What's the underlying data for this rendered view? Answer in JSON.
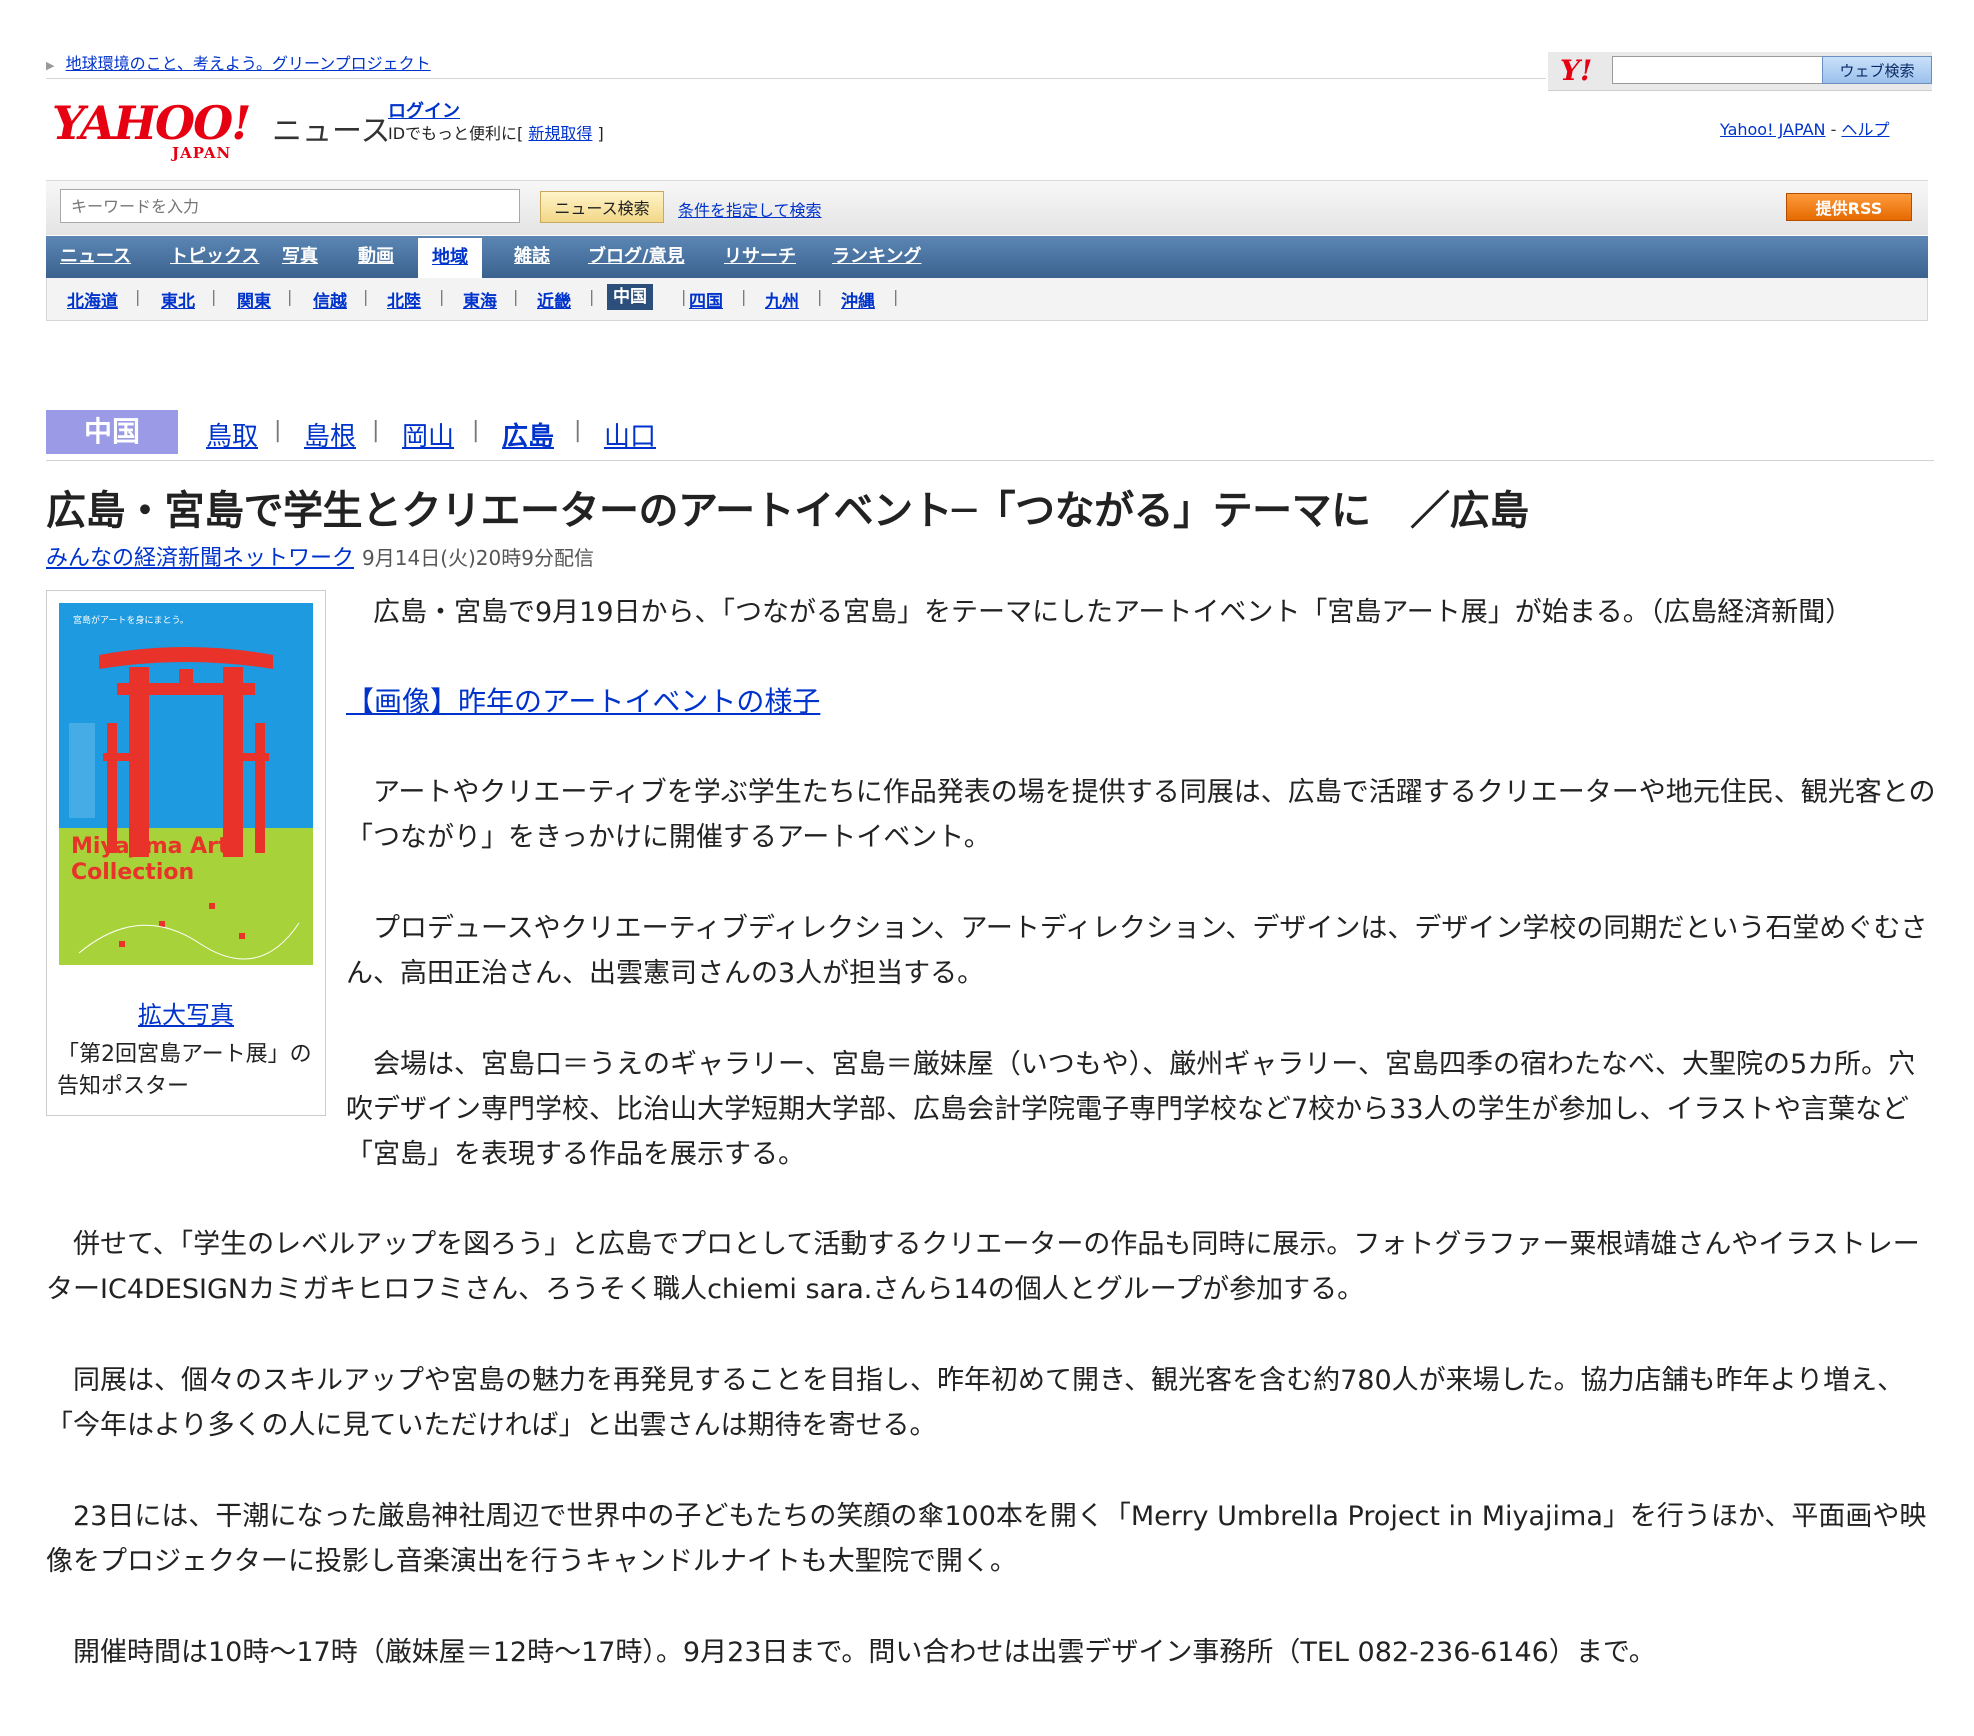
{
  "header": {
    "green_link": "地球環境のこと、考えよう。グリーンプロジェクト",
    "yahoo_small_logo": "Y!",
    "web_search_button": "ウェブ検索",
    "logo_text": "YAHOO!",
    "logo_sub": "JAPAN",
    "news_label": "ニュース",
    "login_link": "ログイン",
    "login_desc_prefix": "IDでもっと便利に[",
    "signup_link": "新規取得",
    "login_desc_suffix": "]",
    "yahoo_japan_link": "Yahoo! JAPAN",
    "dash": "-",
    "help_link": "ヘルプ"
  },
  "search": {
    "keyword_placeholder": "キーワードを入力",
    "news_search_button": "ニュース検索",
    "condition_link": "条件を指定して検索",
    "rss_button": "提供RSS"
  },
  "main_nav": [
    {
      "label": "ニュース"
    },
    {
      "label": "トピックス"
    },
    {
      "label": "写真"
    },
    {
      "label": "動画"
    },
    {
      "label": "地域"
    },
    {
      "label": "雑誌"
    },
    {
      "label": "ブログ/意見"
    },
    {
      "label": "リサーチ"
    },
    {
      "label": "ランキング"
    }
  ],
  "sub_nav": [
    {
      "label": "北海道"
    },
    {
      "label": "東北"
    },
    {
      "label": "関東"
    },
    {
      "label": "信越"
    },
    {
      "label": "北陸"
    },
    {
      "label": "東海"
    },
    {
      "label": "近畿"
    },
    {
      "label": "中国"
    },
    {
      "label": "四国"
    },
    {
      "label": "九州"
    },
    {
      "label": "沖縄"
    }
  ],
  "sub_nav_separator": "|",
  "prefectures": {
    "region": "中国",
    "items": [
      {
        "label": "鳥取"
      },
      {
        "label": "島根"
      },
      {
        "label": "岡山"
      },
      {
        "label": "広島"
      },
      {
        "label": "山口"
      }
    ]
  },
  "article": {
    "headline": "広島・宮島で学生とクリエーターのアートイベント─「つながる」テーマに　／広島",
    "source_link": "みんなの経済新聞ネットワーク",
    "date": "9月14日(火)20時9分配信",
    "poster_top_text": "宮島がアートを身にまとう。",
    "poster_title_1": "Miyajima Art",
    "poster_title_2": "Collection",
    "enlarge_link": "拡大写真",
    "caption": "「第2回宮島アート展」の告知ポスター",
    "lead": "　広島・宮島で9月19日から、「つながる宮島」をテーマにしたアートイベント「宮島アート展」が始まる。（広島経済新聞）",
    "image_link": "【画像】昨年のアートイベントの様子",
    "paragraphs": [
      "　アートやクリエーティブを学ぶ学生たちに作品発表の場を提供する同展は、広島で活躍するクリエーターや地元住民、観光客との「つながり」をきっかけに開催するアートイベント。",
      "　プロデュースやクリエーティブディレクション、アートディレクション、デザインは、デザイン学校の同期だという石堂めぐむさん、高田正治さん、出雲憲司さんの3人が担当する。",
      "　会場は、宮島口＝うえのギャラリー、宮島＝厳妹屋（いつもや）、厳州ギャラリー、宮島四季の宿わたなべ、大聖院の5カ所。穴吹デザイン専門学校、比治山大学短期大学部、広島会計学院電子専門学校など7校から33人の学生が参加し、イラストや言葉など「宮島」を表現する作品を展示する。",
      "　併せて、「学生のレベルアップを図ろう」と広島でプロとして活動するクリエーターの作品も同時に展示。フォトグラファー粟根靖雄さんやイラストレーターIC4DESIGNカミガキヒロフミさん、ろうそく職人chiemi sara.さんら14の個人とグループが参加する。",
      "　同展は、個々のスキルアップや宮島の魅力を再発見することを目指し、昨年初めて開き、観光客を含む約780人が来場した。協力店舗も昨年より増え、「今年はより多くの人に見ていただければ」と出雲さんは期待を寄せる。",
      "　23日には、干潮になった厳島神社周辺で世界中の子どもたちの笑顔の傘100本を開く「Merry Umbrella Project in Miyajima」を行うほか、平面画や映像をプロジェクターに投影し音楽演出を行うキャンドルナイトも大聖院で開く。",
      "　開催時間は10時～17時（厳妹屋＝12時～17時）。9月23日まで。問い合わせは出雲デザイン事務所（TEL 082-236-6146）まで。"
    ]
  },
  "colors": {
    "yahoo_red": "#e60012",
    "nav_blue": "#3b628f",
    "link_blue": "#0033cc",
    "region_purple": "#9a9ae6",
    "rss_orange": "#f07d12",
    "poster_blue": "#1e9ae0",
    "poster_green": "#a8d23a",
    "torii_red": "#e8322a"
  }
}
